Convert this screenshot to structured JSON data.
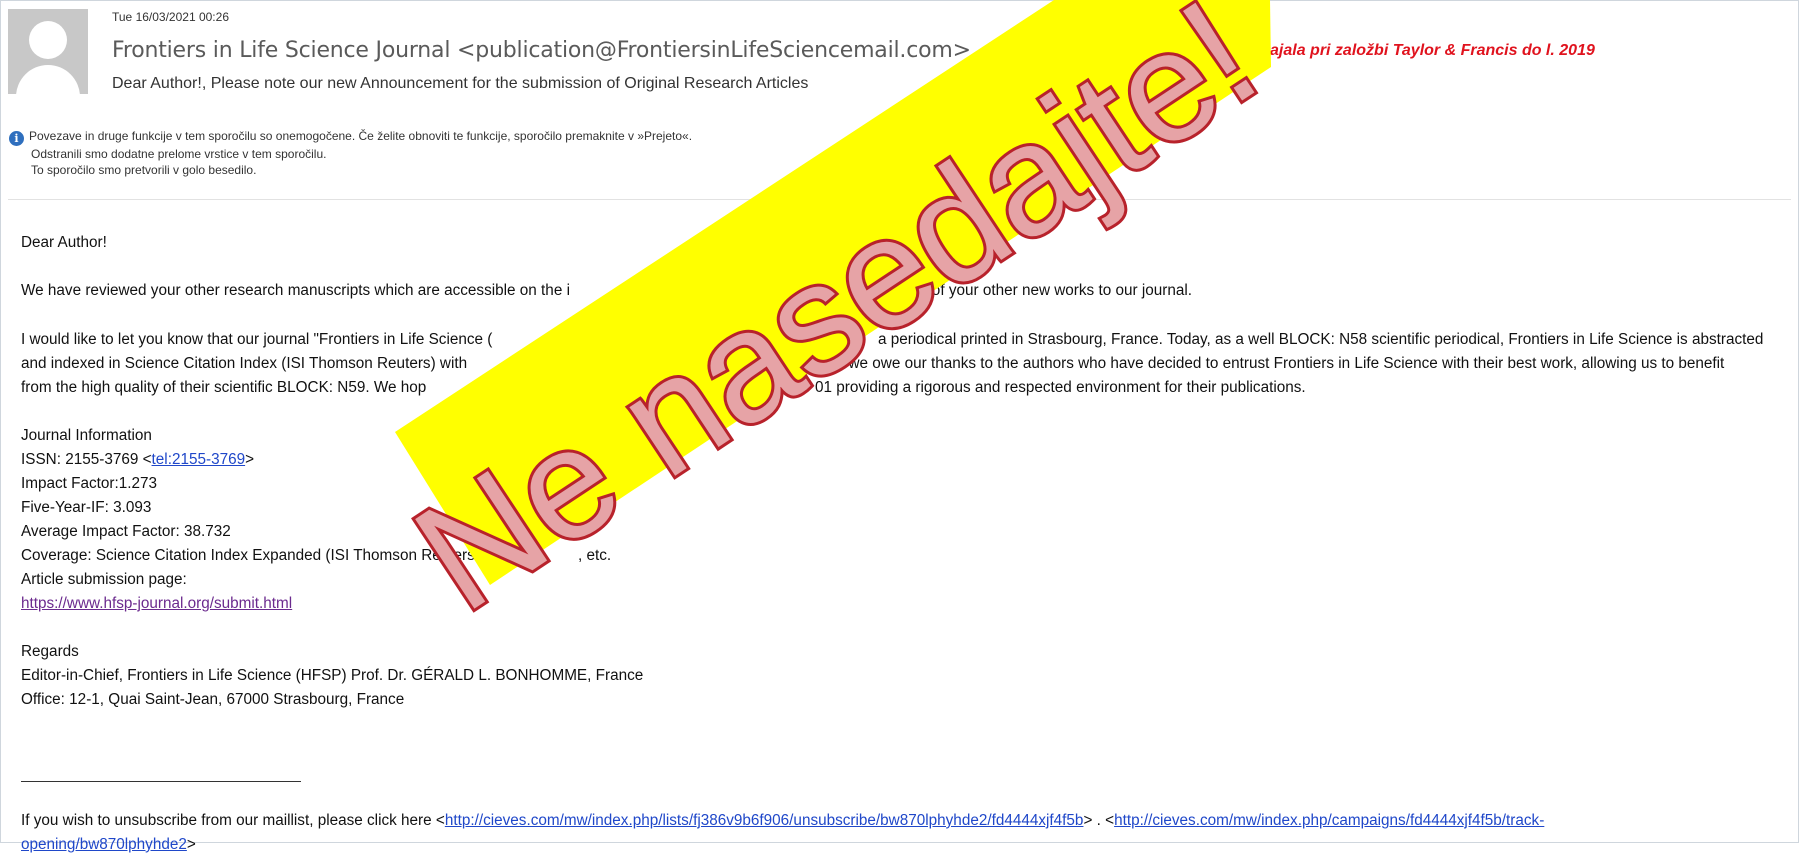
{
  "header": {
    "date": "Tue 16/03/2021 00:26",
    "sender": "Frontiers in Life Science Journal <publication@FrontiersinLifeSciencemail.com>",
    "subject": "Dear Author!, Please note our new Announcement for the submission of Original Research Articles",
    "red_note": "ie izhajala pri založbi Taylor & Francis do l. 2019"
  },
  "info": {
    "line1": "Povezave in druge funkcije v tem sporočilu so onemogočene. Če želite obnoviti te funkcije, sporočilo premaknite v »Prejeto«.",
    "line2": "Odstranili smo dodatne prelome vrstice v tem sporočilu.",
    "line3": "To sporočilo smo pretvorili v golo besedilo."
  },
  "body": {
    "greeting": "Dear Author!",
    "para1": "We have reviewed your other research manuscripts which are accessible on the i",
    "para1_end": "it any of your other new works to our journal.",
    "para2_l1a": "I would like to let you know that our journal \"Frontiers in Life Science (",
    "para2_l1b": "a periodical printed in Strasbourg, France. Today, as a well BLOCK: N58 scientific periodical, Frontiers in Life Science is abstracted",
    "para2_l2a": "and indexed in Science Citation Index (ISI Thomson Reuters) with",
    "para2_l2b": ", we owe our thanks to the authors who have decided to entrust Frontiers in Life Science with their best work, allowing us to benefit",
    "para2_l3a": "from the high quality of their scientific BLOCK: N59. We hop",
    "para2_l3b": "01 providing a rigorous and respected environment for their publications.",
    "journal_info": "Journal Information",
    "issn_label": "ISSN: 2155-3769 <",
    "issn_link": "tel:2155-3769",
    "issn_close": ">",
    "impact": "Impact Factor:1.273",
    "five_year": "Five-Year-IF: 3.093",
    "avg_impact": "Average Impact Factor: 38.732",
    "coverage": "Coverage: Science Citation Index Expanded (ISI Thomson Reuters",
    "coverage_end": ", etc.",
    "submission_label": "Article submission page:",
    "submission_url": "https://www.hfsp-journal.org/submit.html",
    "regards": "Regards",
    "editor": "Editor-in-Chief, Frontiers in Life Science (HFSP) Prof. Dr. GÉRALD L. BONHOMME, France",
    "office": "Office: 12-1, Quai Saint-Jean, 67000 Strasbourg, France"
  },
  "footer": {
    "unsubscribe_prefix": "If you wish to unsubscribe from our maillist, please click here <",
    "unsubscribe_url": "http://cieves.com/mw/index.php/lists/fj386v9b6f906/unsubscribe/bw870lphyhde2/fd4444xjf4f5b",
    "mid": "> . <",
    "track_url": "http://cieves.com/mw/index.php/campaigns/fd4444xjf4f5b/track-",
    "track_url_l2": "opening/bw870lphyhde2",
    "track_close": ">"
  },
  "banner": {
    "text": "Ne nasedajte!",
    "bg_color": "#ffff00",
    "text_fill": "#e6a3a6",
    "text_stroke": "#b8222b"
  },
  "colors": {
    "link": "#1f47c9",
    "visited_link": "#6b2a8e",
    "warning_red": "#e0131e",
    "info_icon": "#2f6fbe"
  }
}
